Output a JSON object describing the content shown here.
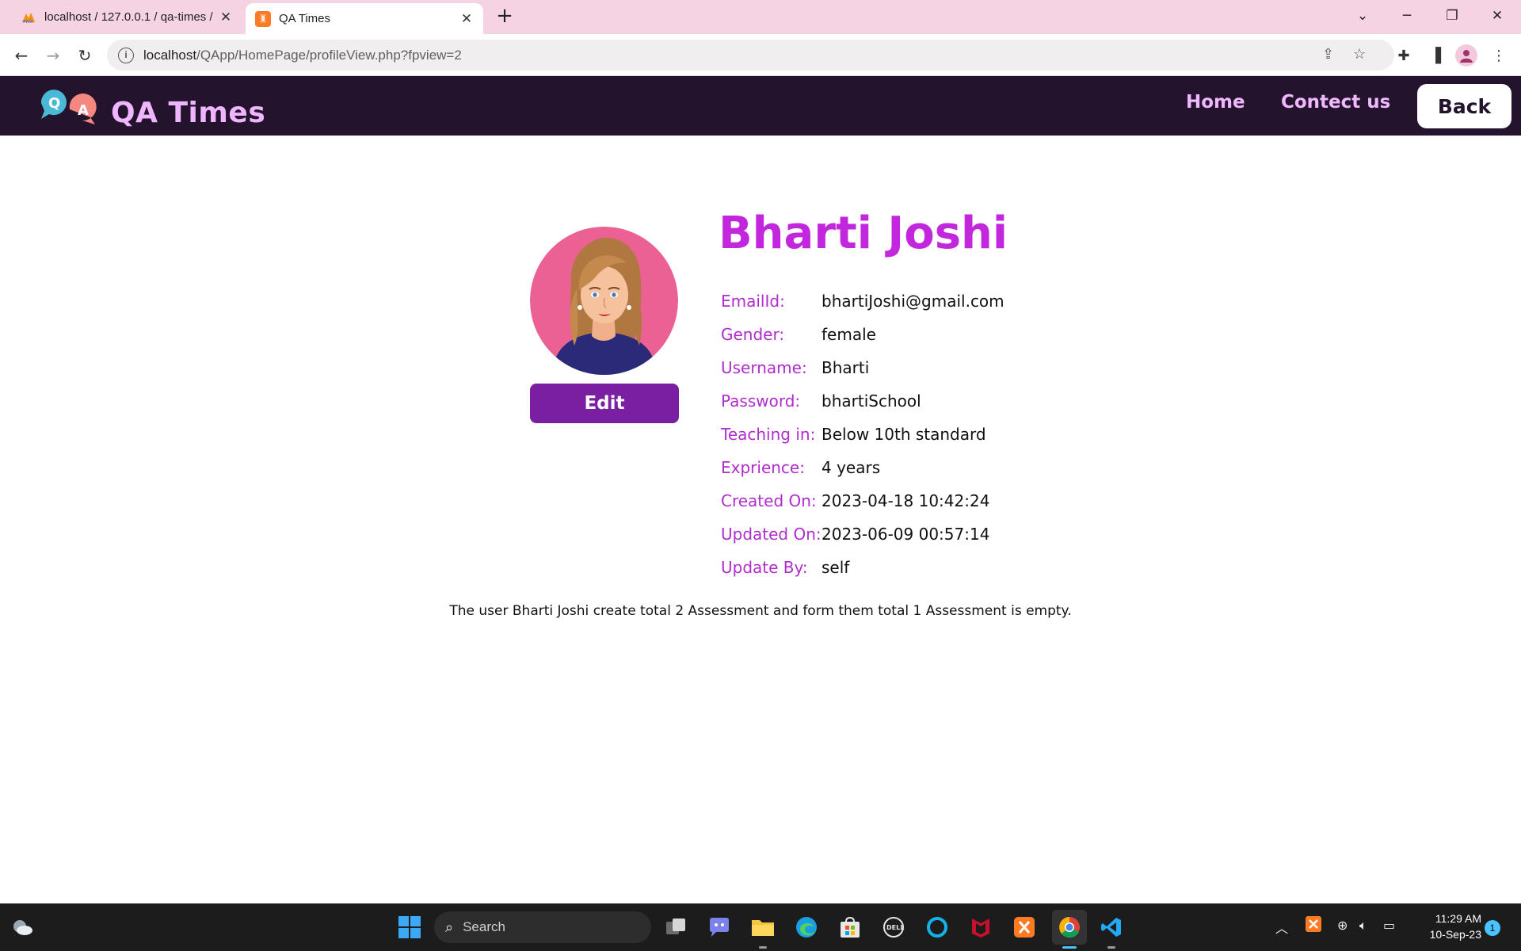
{
  "browser": {
    "tabs": [
      {
        "title": "localhost / 127.0.0.1 / qa-times /",
        "active": false,
        "icon": "phpmyadmin-icon"
      },
      {
        "title": "QA Times",
        "active": true,
        "icon": "xampp-icon"
      }
    ],
    "url_host": "localhost",
    "url_path": "/QApp/HomePage/profileView.php?fpview=2"
  },
  "site": {
    "brand": "QA Times",
    "logo_letters": [
      "Q",
      "A"
    ],
    "nav": {
      "home": "Home",
      "contact": "Contect us",
      "back": "Back"
    }
  },
  "profile": {
    "name": "Bharti Joshi",
    "edit_label": "Edit",
    "fields": [
      {
        "label": "EmailId:",
        "value": "bhartiJoshi@gmail.com"
      },
      {
        "label": "Gender:",
        "value": "female"
      },
      {
        "label": "Username:",
        "value": "Bharti"
      },
      {
        "label": "Password:",
        "value": "bhartiSchool"
      },
      {
        "label": "Teaching in:",
        "value": "Below 10th standard"
      },
      {
        "label": "Exprience:",
        "value": "4 years"
      },
      {
        "label": "Created On:",
        "value": "2023-04-18 10:42:24"
      },
      {
        "label": "Updated On:",
        "value": "2023-06-09 00:57:14"
      },
      {
        "label": "Update By:",
        "value": "self"
      }
    ],
    "summary": "The user Bharti Joshi create total 2 Assessment and form them total 1 Assessment is empty."
  },
  "taskbar": {
    "search_placeholder": "Search",
    "time": "11:29 AM",
    "date": "10-Sep-23",
    "notification_count": "1"
  },
  "colors": {
    "header_bg": "#23132d",
    "brand": "#f0b5ff",
    "accent": "#c227dd",
    "label": "#b02ccd",
    "edit_button": "#7b1fa2",
    "tabbar": "#f5d3e3"
  }
}
